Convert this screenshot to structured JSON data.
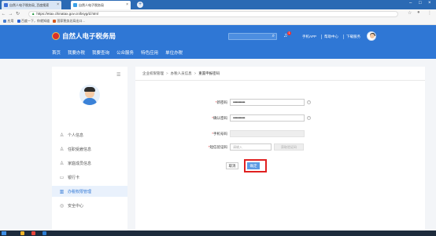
{
  "browser": {
    "tabs": [
      {
        "label": "自然人电子税务局_百度搜索",
        "favicon_color": "#3b6fd6"
      },
      {
        "label": "自然人电子税务局",
        "favicon_color": "#3ca0e6"
      }
    ],
    "new_tab_glyph": "+",
    "url": "https://etax.chinatax.gov.cn/bsyg/d.html",
    "bookmarks_apps": "应用",
    "bookmarks": [
      {
        "label": "百度一下，你就知道",
        "color": "#2b64d6"
      },
      {
        "label": "国家税务总局出口...",
        "color": "#d85a20"
      }
    ]
  },
  "header": {
    "site_title": "自然人电子税务局",
    "notification_count": "1",
    "links": [
      "手机APP",
      "帮助中心",
      "下载服务"
    ],
    "nav": [
      "首页",
      "我要办税",
      "我要查询",
      "公众服务",
      "特色应用",
      "单位办税"
    ]
  },
  "sidebar": {
    "items": [
      {
        "label": "个人信息",
        "icon": "person-icon",
        "glyph": "♙"
      },
      {
        "label": "任职受雇信息",
        "icon": "employment-icon",
        "glyph": "♙"
      },
      {
        "label": "家庭成员信息",
        "icon": "family-icon",
        "glyph": "♙"
      },
      {
        "label": "银行卡",
        "icon": "bank-card-icon",
        "glyph": "▭"
      },
      {
        "label": "办税权限管理",
        "icon": "permission-icon",
        "glyph": "▥"
      },
      {
        "label": "安全中心",
        "icon": "shield-icon",
        "glyph": "◎"
      }
    ],
    "active_index": 4
  },
  "breadcrumb": [
    "企业权限管理",
    "办税人员信息",
    "重置申报密码"
  ],
  "form": {
    "new_password": {
      "label": "新密码",
      "value": "••••••••••••"
    },
    "confirm_password": {
      "label": "确认密码",
      "value": "••••••••••••"
    },
    "phone": {
      "label": "手机号码",
      "value": ""
    },
    "sms_code": {
      "label": "短信验证码",
      "placeholder": "请输入",
      "send_button": "获取验证码"
    },
    "help_glyph": "?"
  },
  "buttons": {
    "cancel": "取消",
    "confirm": "确定"
  },
  "colors": {
    "brand": "#2f77d5",
    "highlight": "#e02020"
  }
}
